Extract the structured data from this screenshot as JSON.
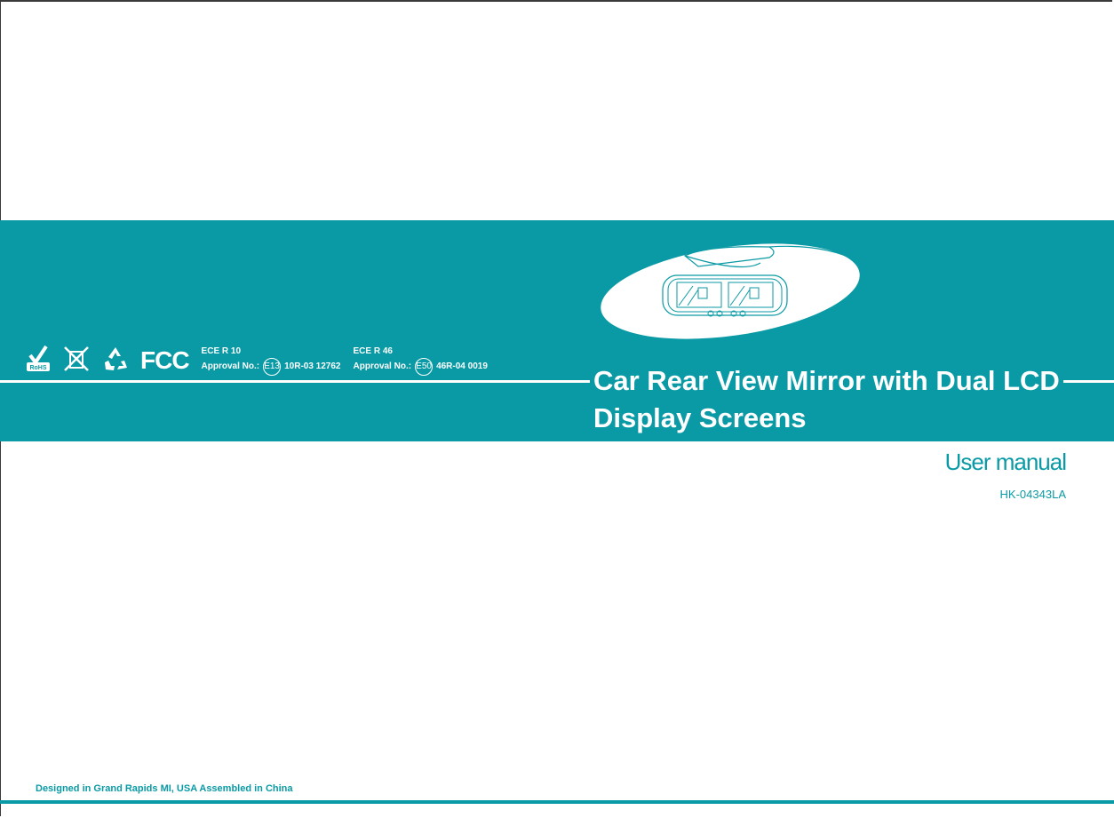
{
  "cover": {
    "title_line1": "Car Rear View Mirror with Dual LCD",
    "title_line2": "Display Screens",
    "subtitle": "User manual",
    "model": "HK-04343LA"
  },
  "certifications": {
    "icons": [
      "rohs-icon",
      "weee-bin-icon",
      "recycle-icon",
      "fcc-logo"
    ],
    "fcc_label": "FCC",
    "ece_r10": {
      "heading": "ECE R 10",
      "approval_label": "Approval No.:",
      "mark": "E13",
      "number": "10R-03 12762"
    },
    "ece_r46": {
      "heading": "ECE R 46",
      "approval_label": "Approval No.:",
      "mark": "E50",
      "number": "46R-04 0019"
    }
  },
  "footer": {
    "text": "Designed in Grand Rapids MI, USA  Assembled in China"
  },
  "colors": {
    "brand": "#0a9aa5",
    "text_on_brand": "#ffffff"
  }
}
